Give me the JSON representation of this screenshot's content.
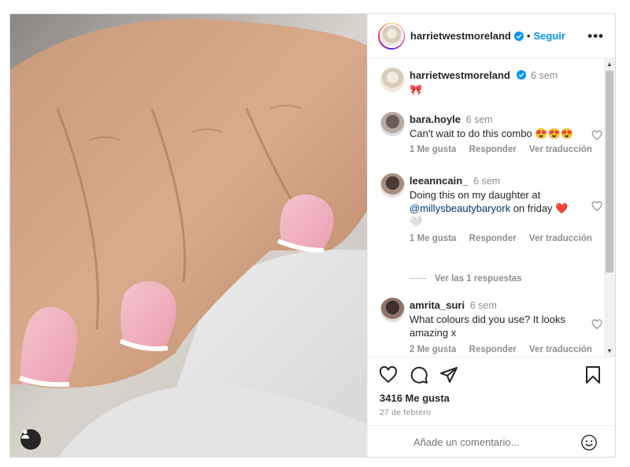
{
  "post": {
    "author": "harrietwestmoreland",
    "follow_label": "Seguir",
    "separator": "•",
    "more_label": "•••",
    "caption": "🎀",
    "caption_time": "6 sem",
    "likes": "3416 Me gusta",
    "date": "27 de febrero",
    "comment_placeholder": "Añade un comentario..."
  },
  "comments": [
    {
      "user": "bara.hoyle",
      "time": "6 sem",
      "text": "Can't wait to do this combo 😍😍😍",
      "likes": "1 Me gusta",
      "reply": "Responder",
      "translate": "Ver traducción"
    },
    {
      "user": "leeanncain_",
      "time": "6 sem",
      "text_before": "Doing this on my daughter at ",
      "mention": "@millysbeautybaryork",
      "text_after": " on friday ❤️ 🤍",
      "likes": "1 Me gusta",
      "reply": "Responder",
      "translate": "Ver traducción",
      "replies": "Ver las 1 respuestas"
    },
    {
      "user": "amrita_suri",
      "time": "6 sem",
      "text": "What colours did you use? It looks amazing x",
      "likes": "2 Me gusta",
      "reply": "Responder",
      "translate": "Ver traducción"
    }
  ],
  "colors": {
    "accent": "#0095f6",
    "verified": "#0095f6",
    "heart_red": "#e0245e"
  },
  "icons": [
    "heart-icon",
    "comment-icon",
    "share-icon",
    "save-icon",
    "emoji-icon",
    "user-tag-icon",
    "verified-icon"
  ]
}
